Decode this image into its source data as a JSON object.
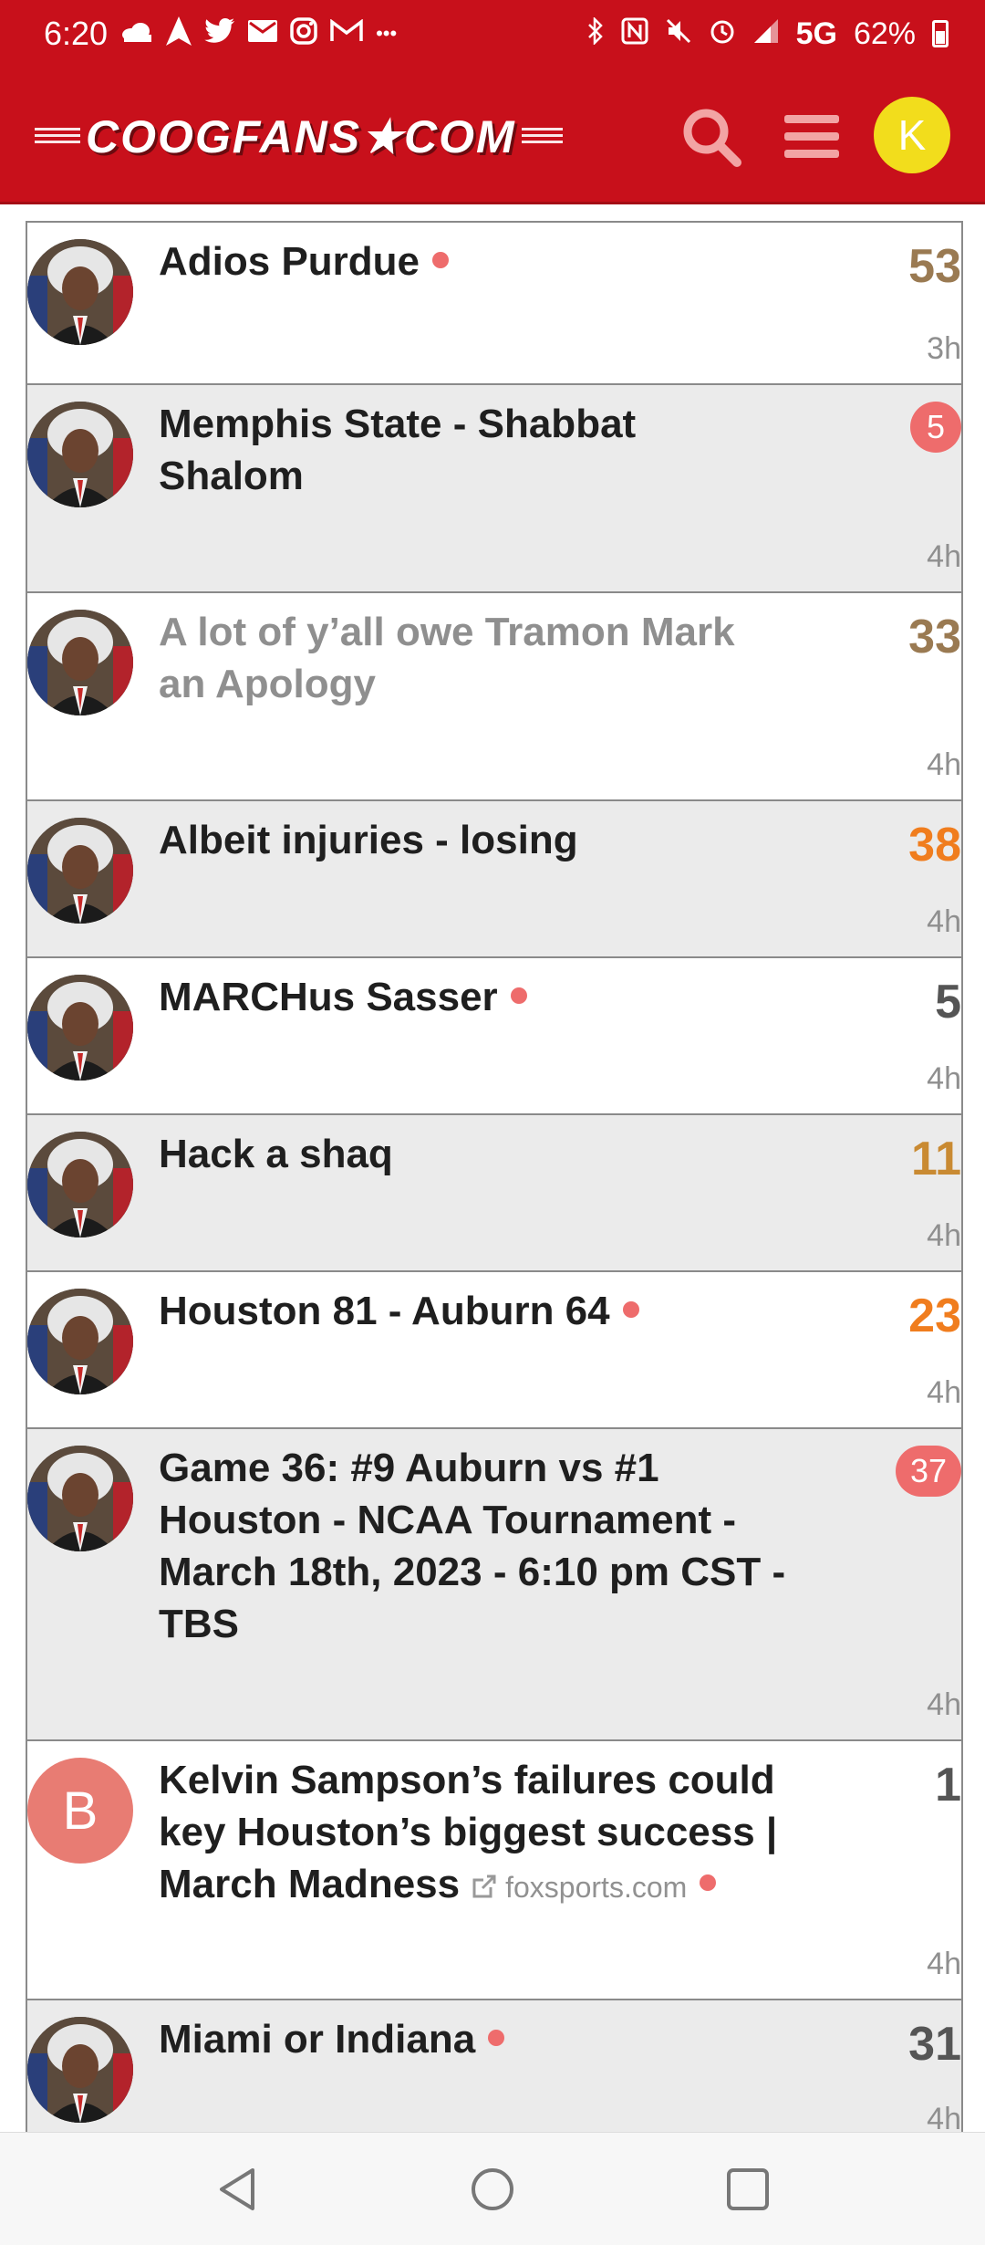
{
  "status_bar": {
    "time": "6:20",
    "network": "5G",
    "battery": "62%",
    "left_icons": [
      "cloud-icon",
      "navigation-icon",
      "twitter-icon",
      "mail-icon",
      "instagram-icon",
      "gmail-icon",
      "more-icon"
    ],
    "right_icons": [
      "bluetooth-icon",
      "nfc-icon",
      "mute-icon",
      "alarm-icon",
      "signal-icon",
      "battery-icon"
    ]
  },
  "header": {
    "logo_text": "COOGFANS★COM",
    "avatar_letter": "K",
    "colors": {
      "brand": "#c8101b",
      "avatar": "#f2dd1c"
    }
  },
  "topics": [
    {
      "title": "Adios Purdue",
      "unread_dot": true,
      "count": "53",
      "count_color": "#9a7a52",
      "age": "3h",
      "avatar": "photo",
      "bg": "white",
      "visited": false,
      "badge": false
    },
    {
      "title": "Memphis State - Shabbat Shalom",
      "unread_dot": false,
      "count": "5",
      "count_color": "#ffffff",
      "age": "4h",
      "avatar": "photo",
      "bg": "gray",
      "visited": false,
      "badge": true
    },
    {
      "title": "A lot of y’all owe Tramon Mark an Apology",
      "unread_dot": false,
      "count": "33",
      "count_color": "#9a7a52",
      "age": "4h",
      "avatar": "photo",
      "bg": "white",
      "visited": true,
      "badge": false
    },
    {
      "title": "Albeit injuries - losing",
      "unread_dot": false,
      "count": "38",
      "count_color": "#f07d1e",
      "age": "4h",
      "avatar": "photo",
      "bg": "gray",
      "visited": false,
      "badge": false
    },
    {
      "title": "MARCHus Sasser",
      "unread_dot": true,
      "count": "5",
      "count_color": "#555555",
      "age": "4h",
      "avatar": "photo",
      "bg": "white",
      "visited": false,
      "badge": false
    },
    {
      "title": "Hack a shaq",
      "unread_dot": false,
      "count": "11",
      "count_color": "#c98a32",
      "age": "4h",
      "avatar": "photo",
      "bg": "gray",
      "visited": false,
      "badge": false
    },
    {
      "title": "Houston 81 - Auburn 64",
      "unread_dot": true,
      "count": "23",
      "count_color": "#f07d1e",
      "age": "4h",
      "avatar": "photo",
      "bg": "white",
      "visited": false,
      "badge": false
    },
    {
      "title": "Game 36: #9 Auburn vs #1 Houston - NCAA Tournament - March 18th, 2023 - 6:10 pm CST - TBS",
      "unread_dot": false,
      "count": "37",
      "count_color": "#ffffff",
      "age": "4h",
      "avatar": "photo",
      "bg": "gray",
      "visited": false,
      "badge": true
    },
    {
      "title": "Kelvin Sampson’s failures could key Houston’s biggest success | March Madness",
      "unread_dot": true,
      "count": "1",
      "count_color": "#555555",
      "age": "4h",
      "avatar": "letter",
      "avatar_letter": "B",
      "domain": "foxsports.com",
      "bg": "white",
      "visited": false,
      "badge": false
    },
    {
      "title": "Miami or Indiana",
      "unread_dot": true,
      "count": "31",
      "count_color": "#555555",
      "age": "4h",
      "avatar": "photo",
      "bg": "gray",
      "visited": false,
      "badge": false
    }
  ],
  "nav_bar": {
    "buttons": [
      "back-icon",
      "home-icon",
      "recents-icon"
    ]
  }
}
